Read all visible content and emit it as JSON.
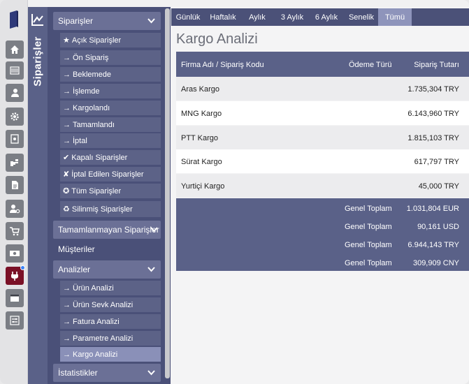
{
  "sidebar_title": "Siparişler",
  "menu": {
    "sections": [
      {
        "label": "Siparişler",
        "expanded": true
      },
      {
        "label": "Tamamlanmayan Siparişler",
        "expanded": false
      },
      {
        "label": "Müşteriler"
      },
      {
        "label": "Analizler",
        "expanded": true
      },
      {
        "label": "İstatistikler",
        "expanded": false
      }
    ],
    "orders_items": [
      {
        "glyph": "★",
        "label": "Açık Siparişler"
      },
      {
        "glyph": "→",
        "label": "Ön Sipariş"
      },
      {
        "glyph": "→",
        "label": "Beklemede"
      },
      {
        "glyph": "→",
        "label": "İşlemde"
      },
      {
        "glyph": "→",
        "label": "Kargolandı"
      },
      {
        "glyph": "→",
        "label": "Tamamlandı"
      },
      {
        "glyph": "→",
        "label": "İptal"
      },
      {
        "glyph": "✔",
        "label": "Kapalı Siparişler"
      },
      {
        "glyph": "✘",
        "label": "İptal Edilen Siparişler"
      },
      {
        "glyph": "✪",
        "label": "Tüm Siparişler"
      },
      {
        "glyph": "♻",
        "label": "Silinmiş Siparişler"
      }
    ],
    "analysis_items": [
      {
        "glyph": "→",
        "label": "Ürün Analizi"
      },
      {
        "glyph": "→",
        "label": "Ürün Sevk Analizi"
      },
      {
        "glyph": "→",
        "label": "Fatura Analizi"
      },
      {
        "glyph": "→",
        "label": "Parametre Analizi"
      },
      {
        "glyph": "→",
        "label": "Kargo Analizi",
        "active": true
      }
    ]
  },
  "rail_icons": [
    "book-icon",
    "home-icon",
    "barcode-icon",
    "user-icon",
    "gear-icon",
    "safe-icon",
    "hand-icon",
    "document-icon",
    "user-settings-icon",
    "cart-icon",
    "money-icon",
    "plug-icon",
    "window-icon",
    "sliders-icon"
  ],
  "tabs": [
    {
      "label": "Günlük"
    },
    {
      "label": "Haftalık"
    },
    {
      "label": "Aylık"
    },
    {
      "label": "3 Aylık"
    },
    {
      "label": "6 Aylık"
    },
    {
      "label": "Senelik"
    },
    {
      "label": "Tümü",
      "active": true
    }
  ],
  "page_title": "Kargo Analizi",
  "table": {
    "headers": {
      "company": "Firma Adı / Sipariş Kodu",
      "payment": "Ödeme Türü",
      "amount": "Sipariş Tutarı"
    },
    "rows": [
      {
        "company": "Aras Kargo",
        "payment": "",
        "amount": "1.735,304 TRY"
      },
      {
        "company": "MNG Kargo",
        "payment": "",
        "amount": "6.143,960 TRY"
      },
      {
        "company": "PTT Kargo",
        "payment": "",
        "amount": "1.815,103 TRY"
      },
      {
        "company": "Sürat Kargo",
        "payment": "",
        "amount": "617,797 TRY"
      },
      {
        "company": "Yurtiçi Kargo",
        "payment": "",
        "amount": "45,000 TRY"
      }
    ],
    "totals": [
      {
        "label": "Genel Toplam",
        "amount": "1.031,804 EUR"
      },
      {
        "label": "Genel Toplam",
        "amount": "90,161 USD"
      },
      {
        "label": "Genel Toplam",
        "amount": "6.944,143 TRY"
      },
      {
        "label": "Genel Toplam",
        "amount": "309,909 CNY"
      }
    ]
  },
  "colors": {
    "accent": "#5a6188",
    "menu_bg": "#4a5078",
    "active_rail": "#7a1026",
    "notification": "#3b82f6"
  }
}
